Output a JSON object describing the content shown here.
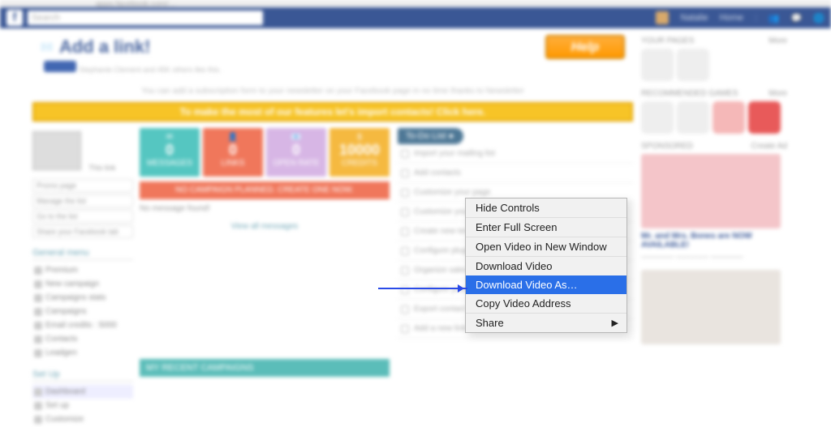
{
  "url_hint": "apps.facebook.com/…",
  "fb": {
    "search_placeholder": "Search",
    "user": "Natalie",
    "home": "Home"
  },
  "app": {
    "title": "Add a link!",
    "like_text": "Stephanie Clement and 45K others like this.",
    "help_label": "Help",
    "info_text": "You can add a subscription form to your newsletter on your Facebook page in no time thanks to Newsletter",
    "yellow_text": "To make the most of our features let's import contacts! Click here."
  },
  "stats": [
    {
      "n": "0",
      "label": "MESSAGES"
    },
    {
      "n": "0",
      "label": "LINKS"
    },
    {
      "n": "0",
      "label": "OPEN RATE"
    },
    {
      "n": "10000",
      "label": "CREDITS"
    }
  ],
  "mini_links": [
    "Promo page",
    "Manage the list",
    "Go to the list",
    "Share your Facebook tab"
  ],
  "red_bar": "NO CAMPAIGN PLANNED. CREATE ONE NOW.",
  "no_msg": "No message found!",
  "view_all": "View all messages",
  "general_menu_h": "General menu",
  "general_menu": [
    "Premium",
    "New campaign",
    "Campaigns stats",
    "Campaigns",
    "Email credits : 5000",
    "Contacts",
    "Leadgen"
  ],
  "setup_h": "Set Up",
  "setup_menu": [
    "Dashboard",
    "Set up",
    "Customize"
  ],
  "todo": {
    "label": "To-Do List",
    "items": [
      "Import your mailing list",
      "Add contacts",
      "Customize your page",
      "Customize your template",
      "Create new templates",
      "Configure plugins",
      "Organize sales / special offers",
      "Configure your automatic newsletter",
      "Export contact form",
      "Add a new link"
    ]
  },
  "recent_h": "MY RECENT CAMPAIGNS",
  "context_menu": [
    {
      "label": "Hide Controls",
      "sel": false
    },
    {
      "label": "Enter Full Screen",
      "sel": false,
      "sep": true
    },
    {
      "label": "Open Video in New Window",
      "sel": false,
      "sep": true
    },
    {
      "label": "Download Video",
      "sel": false
    },
    {
      "label": "Download Video As…",
      "sel": true
    },
    {
      "label": "Copy Video Address",
      "sel": false,
      "sep": true
    },
    {
      "label": "Share",
      "sel": false,
      "arrow": true
    }
  ],
  "side": {
    "more": "More",
    "sponsored": "SPONSORED",
    "create_ad": "Create Ad",
    "ad_title": "Mr. and Mrs. Bones are NOW AVAILABLE!"
  }
}
